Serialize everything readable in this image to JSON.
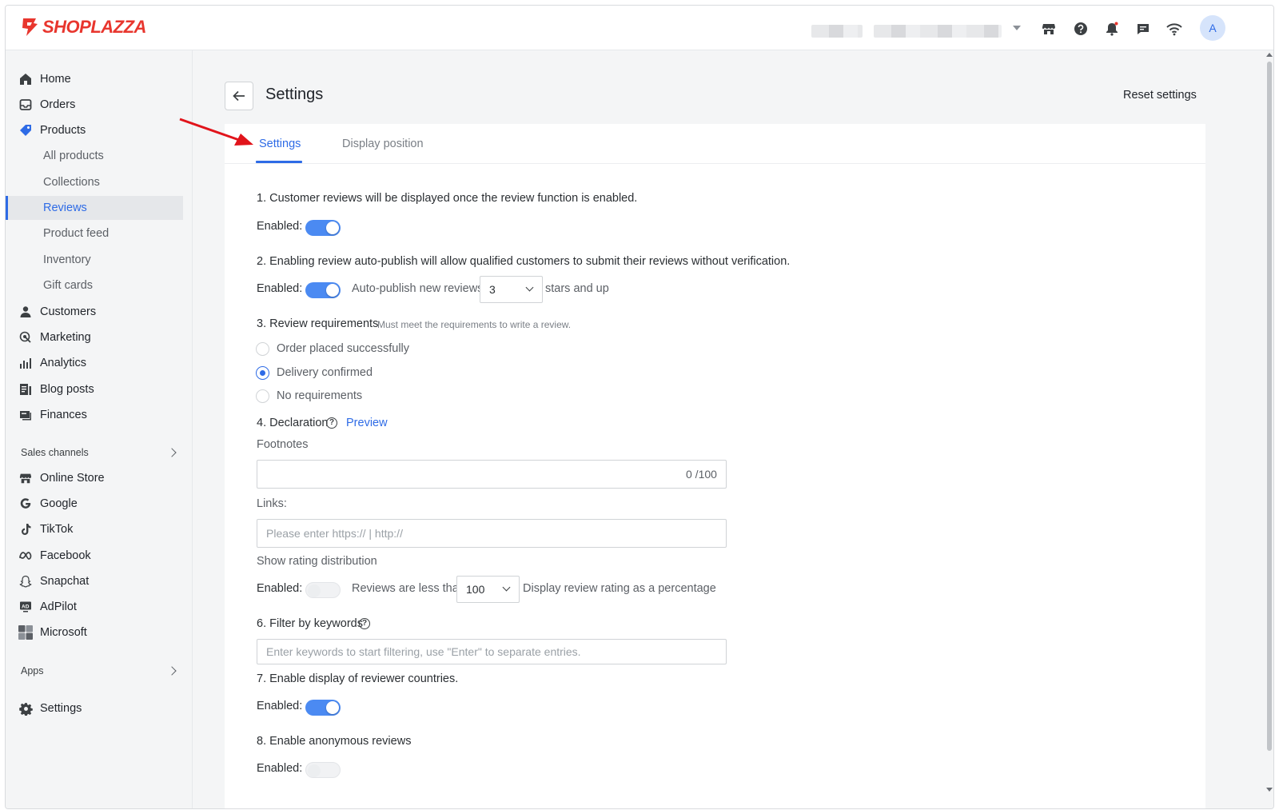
{
  "brand": {
    "name": "SHOPLAZZA",
    "color": "#e8362e"
  },
  "accent_color": "#2e6be6",
  "topbar": {
    "avatar_initial": "A",
    "icons": [
      "store-icon",
      "help-icon",
      "bell-icon",
      "chat-icon",
      "wifi-icon"
    ]
  },
  "sidebar": {
    "items": [
      {
        "label": "Home",
        "icon": "home-icon"
      },
      {
        "label": "Orders",
        "icon": "orders-icon"
      },
      {
        "label": "Products",
        "icon": "tag-icon"
      },
      {
        "label": "All products"
      },
      {
        "label": "Collections"
      },
      {
        "label": "Reviews",
        "active": true
      },
      {
        "label": "Product feed"
      },
      {
        "label": "Inventory"
      },
      {
        "label": "Gift cards"
      },
      {
        "label": "Customers",
        "icon": "person-icon"
      },
      {
        "label": "Marketing",
        "icon": "marketing-icon"
      },
      {
        "label": "Analytics",
        "icon": "analytics-icon"
      },
      {
        "label": "Blog posts",
        "icon": "blog-icon"
      },
      {
        "label": "Finances",
        "icon": "finances-icon"
      }
    ],
    "sales_channels_label": "Sales channels",
    "channels": [
      {
        "label": "Online Store",
        "icon": "store-icon"
      },
      {
        "label": "Google",
        "icon": "google-icon"
      },
      {
        "label": "TikTok",
        "icon": "tiktok-icon"
      },
      {
        "label": "Facebook",
        "icon": "meta-icon"
      },
      {
        "label": "Snapchat",
        "icon": "snapchat-icon"
      },
      {
        "label": "AdPilot",
        "icon": "adpilot-icon"
      },
      {
        "label": "Microsoft",
        "icon": "microsoft-icon"
      }
    ],
    "apps_label": "Apps",
    "settings_label": "Settings"
  },
  "page": {
    "title": "Settings",
    "reset_label": "Reset settings",
    "tabs": [
      {
        "label": "Settings",
        "active": true
      },
      {
        "label": "Display position"
      }
    ]
  },
  "form": {
    "enabled_label": "Enabled",
    "colon": ":",
    "s1": {
      "text": "1. Customer reviews will be displayed once the review function is enabled.",
      "enabled": true
    },
    "s2": {
      "text": "2. Enabling review auto-publish will allow qualified customers to submit their reviews without verification.",
      "enabled": true,
      "auto_label": "Auto-publish new reviews",
      "stars_value": "3",
      "suffix": "stars and up"
    },
    "s3": {
      "text": "3. Review requirements",
      "hint": "Must meet the requirements to write a review.",
      "options": [
        {
          "label": "Order placed successfully",
          "checked": false
        },
        {
          "label": "Delivery confirmed",
          "checked": true
        },
        {
          "label": "No requirements",
          "checked": false
        }
      ]
    },
    "s4": {
      "text": "4. Declaration",
      "preview_label": "Preview",
      "footnotes_label": "Footnotes",
      "footnotes_counter": "0 /100",
      "links_label": "Links:",
      "links_placeholder": "Please enter https:// | http://"
    },
    "s5": {
      "text": "Show rating distribution",
      "enabled": false,
      "less_label": "Reviews are less than",
      "threshold_value": "100",
      "suffix": "Display review rating as a percentage"
    },
    "s6": {
      "text": "6. Filter by keywords",
      "placeholder": "Enter keywords to start filtering, use \"Enter\" to separate entries."
    },
    "s7": {
      "text": "7. Enable display of reviewer countries.",
      "enabled": true
    },
    "s8": {
      "text": "8. Enable anonymous reviews",
      "enabled": false
    }
  }
}
